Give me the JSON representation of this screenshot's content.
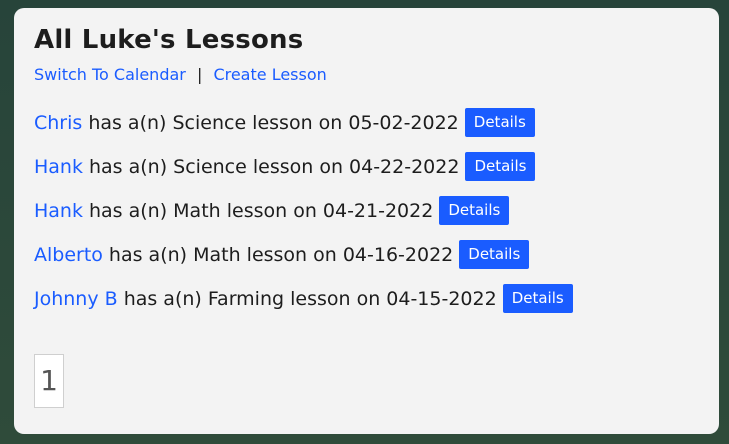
{
  "page": {
    "title": "All Luke's Lessons",
    "actions": {
      "switch_to_calendar": "Switch To Calendar",
      "separator": "|",
      "create_lesson": "Create Lesson"
    }
  },
  "lessons": [
    {
      "student": "Chris",
      "text": "has a(n) Science lesson on 05-02-2022",
      "details_label": "Details"
    },
    {
      "student": "Hank",
      "text": "has a(n) Science lesson on 04-22-2022",
      "details_label": "Details"
    },
    {
      "student": "Hank",
      "text": "has a(n) Math lesson on 04-21-2022",
      "details_label": "Details"
    },
    {
      "student": "Alberto",
      "text": "has a(n) Math lesson on 04-16-2022",
      "details_label": "Details"
    },
    {
      "student": "Johnny B",
      "text": "has a(n) Farming lesson on 04-15-2022",
      "details_label": "Details"
    }
  ],
  "pagination": {
    "current_page": "1"
  },
  "colors": {
    "link": "#1a5cff",
    "button": "#1a5cff",
    "panel_bg": "#f3f3f3",
    "page_bg": "#2f4b3a"
  }
}
